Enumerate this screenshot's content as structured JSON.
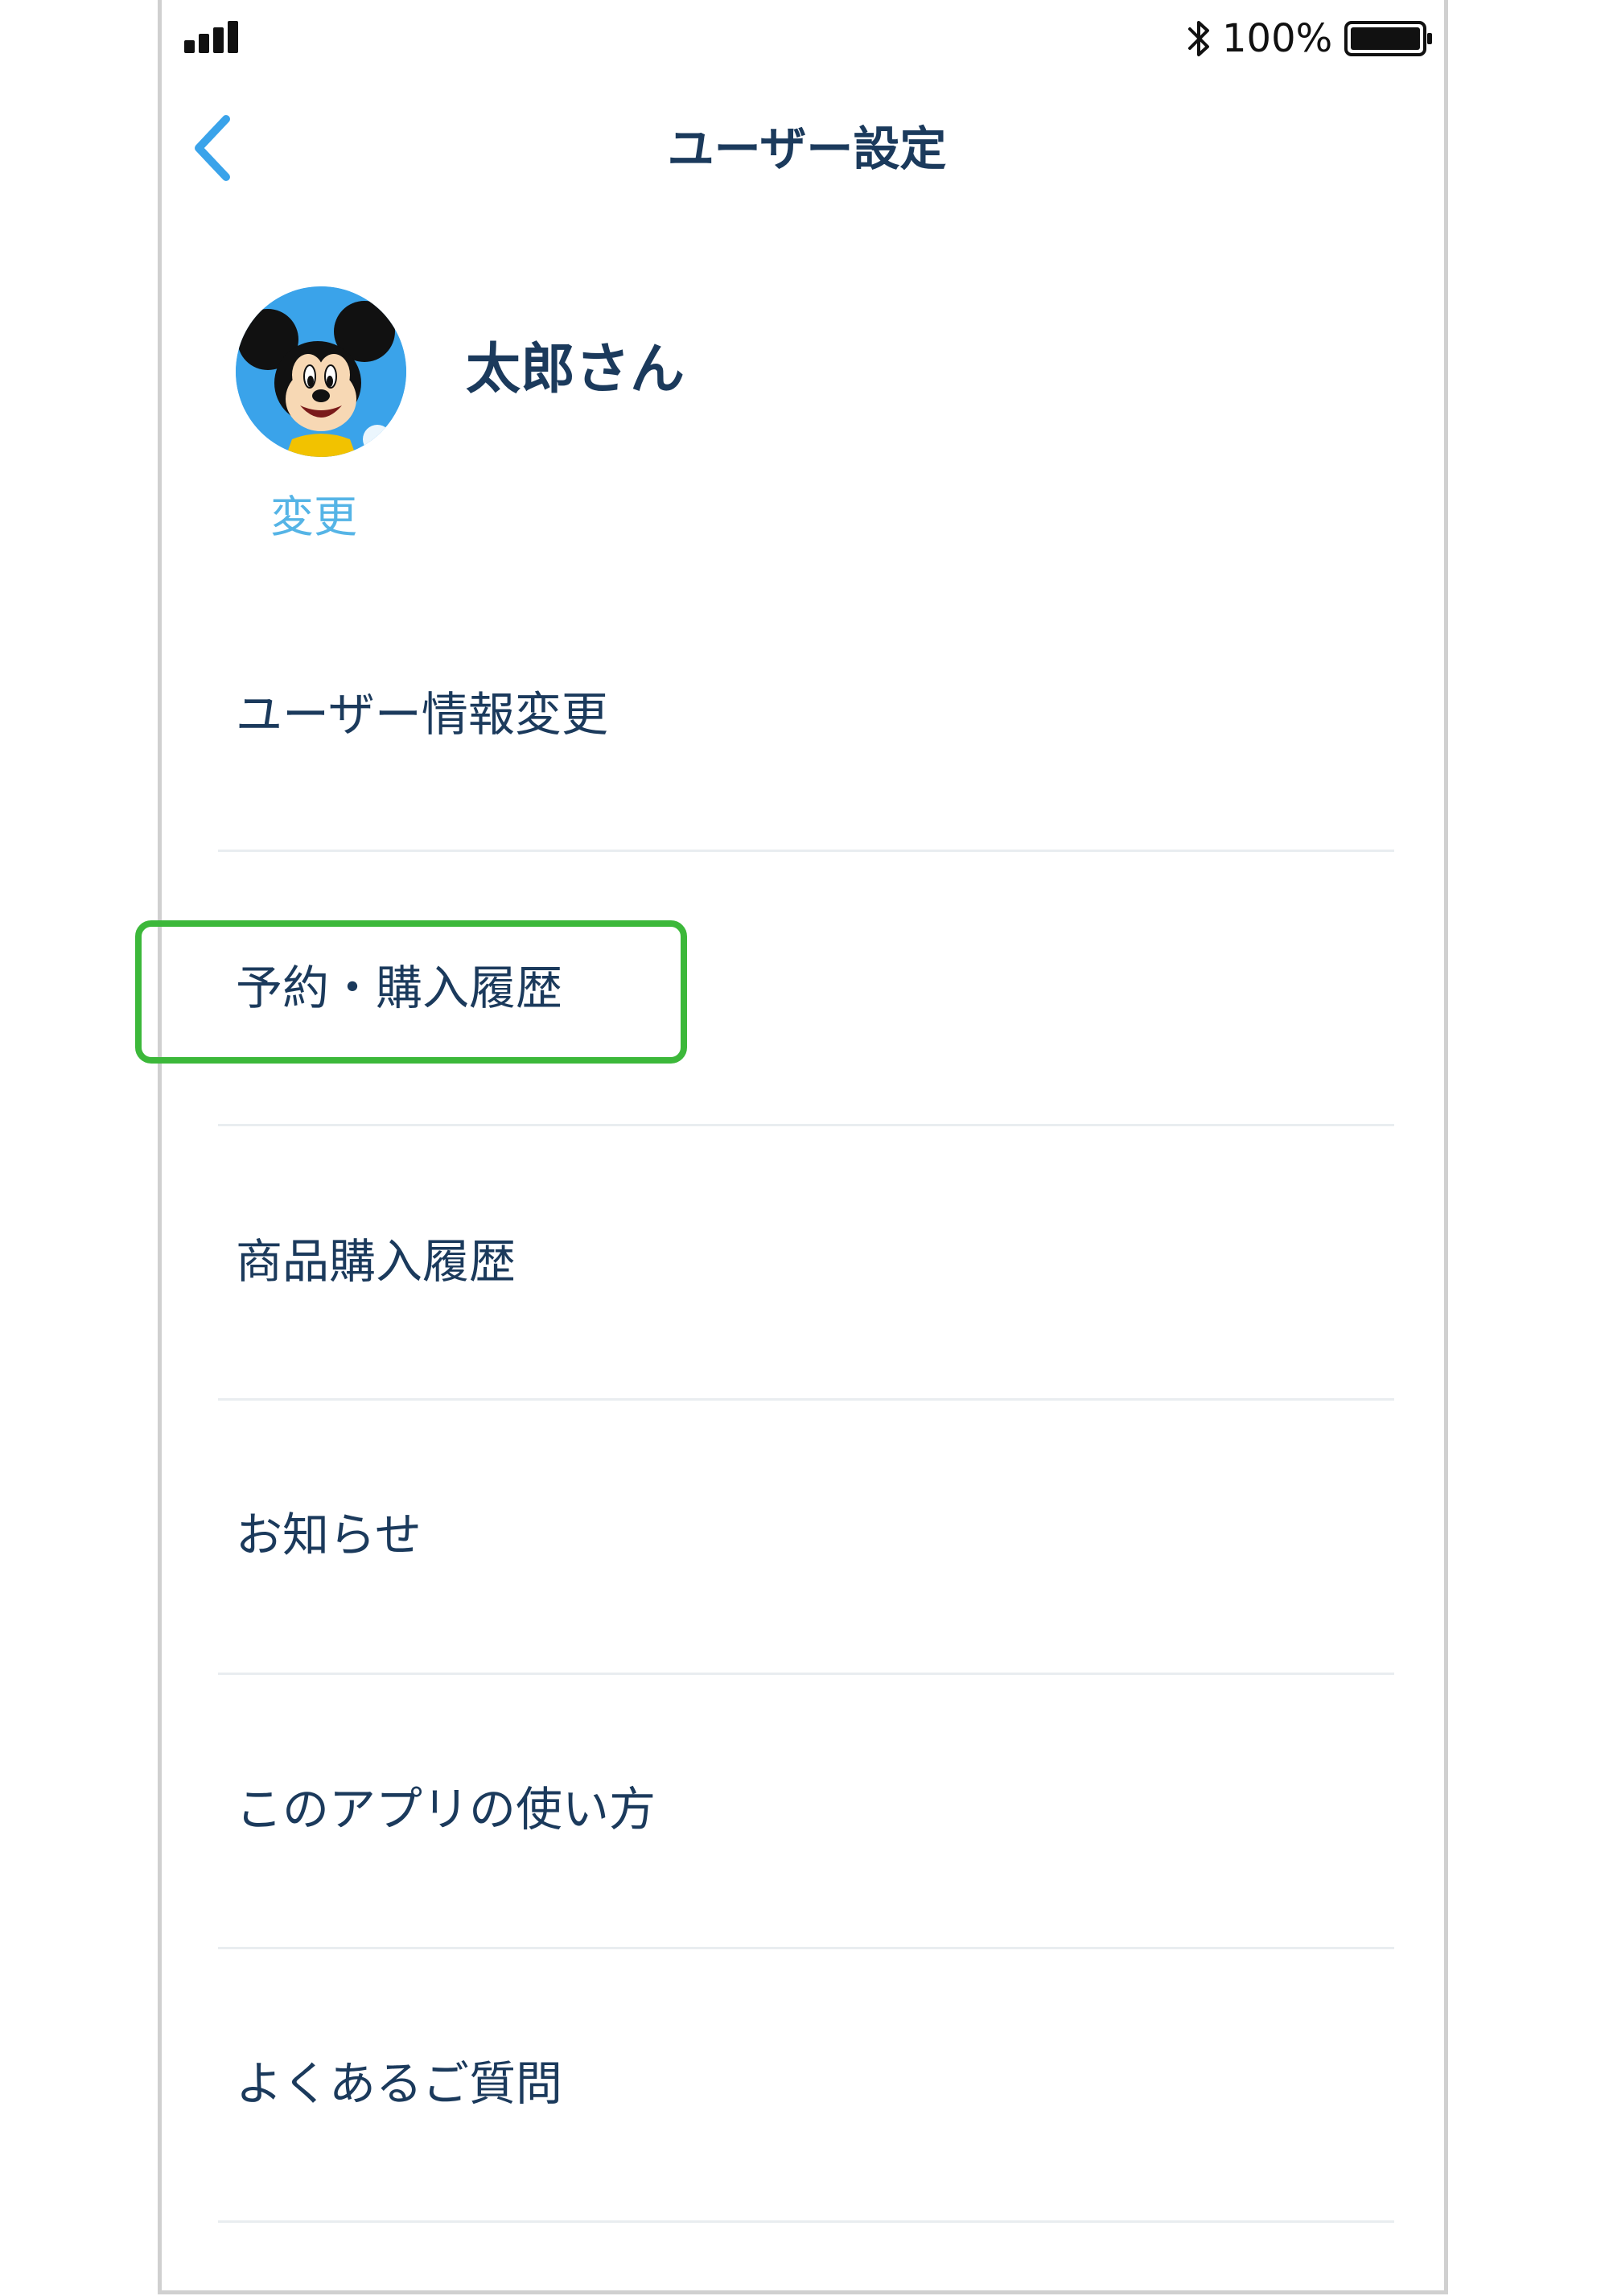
{
  "status_bar": {
    "battery": "100%"
  },
  "nav": {
    "title": "ユーザー設定"
  },
  "profile": {
    "name": "太郎さん",
    "change_label": "変更"
  },
  "menu": {
    "items": [
      {
        "label": "ユーザー情報変更"
      },
      {
        "label": "予約・購入履歴"
      },
      {
        "label": "商品購入履歴"
      },
      {
        "label": "お知らせ"
      },
      {
        "label": "このアプリの使い方"
      },
      {
        "label": "よくあるご質問"
      }
    ]
  },
  "colors": {
    "text_dark": "#1b3a5c",
    "accent_blue": "#3aa3ea",
    "highlight_green": "#3cb83a"
  }
}
